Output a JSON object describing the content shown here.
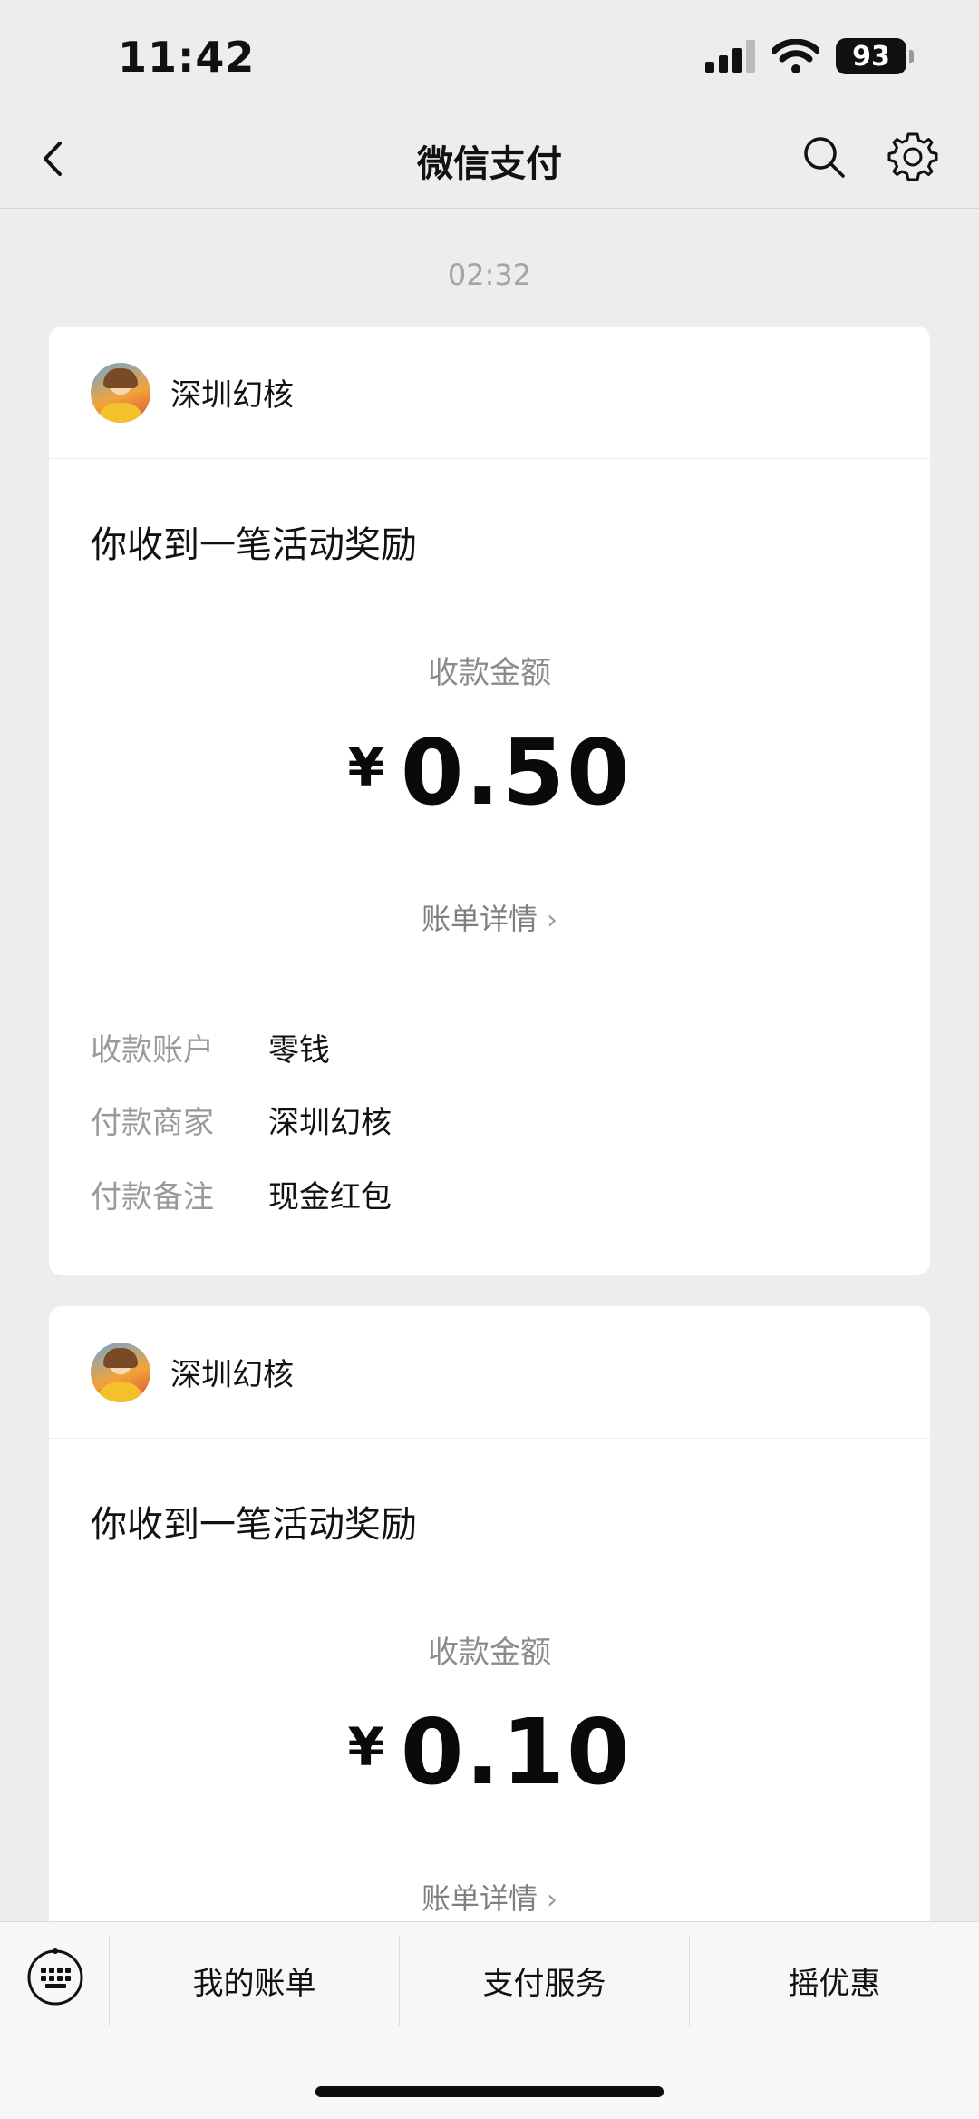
{
  "status_bar": {
    "time": "11:42",
    "battery": "93"
  },
  "nav": {
    "title": "微信支付",
    "icons": [
      "back-chevron-icon",
      "search-icon",
      "gear-icon"
    ]
  },
  "timestamp": "02:32",
  "cards": [
    {
      "merchant": "深圳幻核",
      "title": "你收到一笔活动奖励",
      "amount_label": "收款金额",
      "currency": "¥",
      "amount": "0.50",
      "detail_link": "账单详情",
      "rows": [
        {
          "key": "收款账户",
          "value": "零钱"
        },
        {
          "key": "付款商家",
          "value": "深圳幻核"
        },
        {
          "key": "付款备注",
          "value": "现金红包"
        }
      ]
    },
    {
      "merchant": "深圳幻核",
      "title": "你收到一笔活动奖励",
      "amount_label": "收款金额",
      "currency": "¥",
      "amount": "0.10",
      "detail_link": "账单详情"
    }
  ],
  "bottom_tabs": [
    "我的账单",
    "支付服务",
    "摇优惠"
  ],
  "colors": {
    "background": "#ededed",
    "card": "#ffffff",
    "muted_text": "#8c8c8c"
  }
}
